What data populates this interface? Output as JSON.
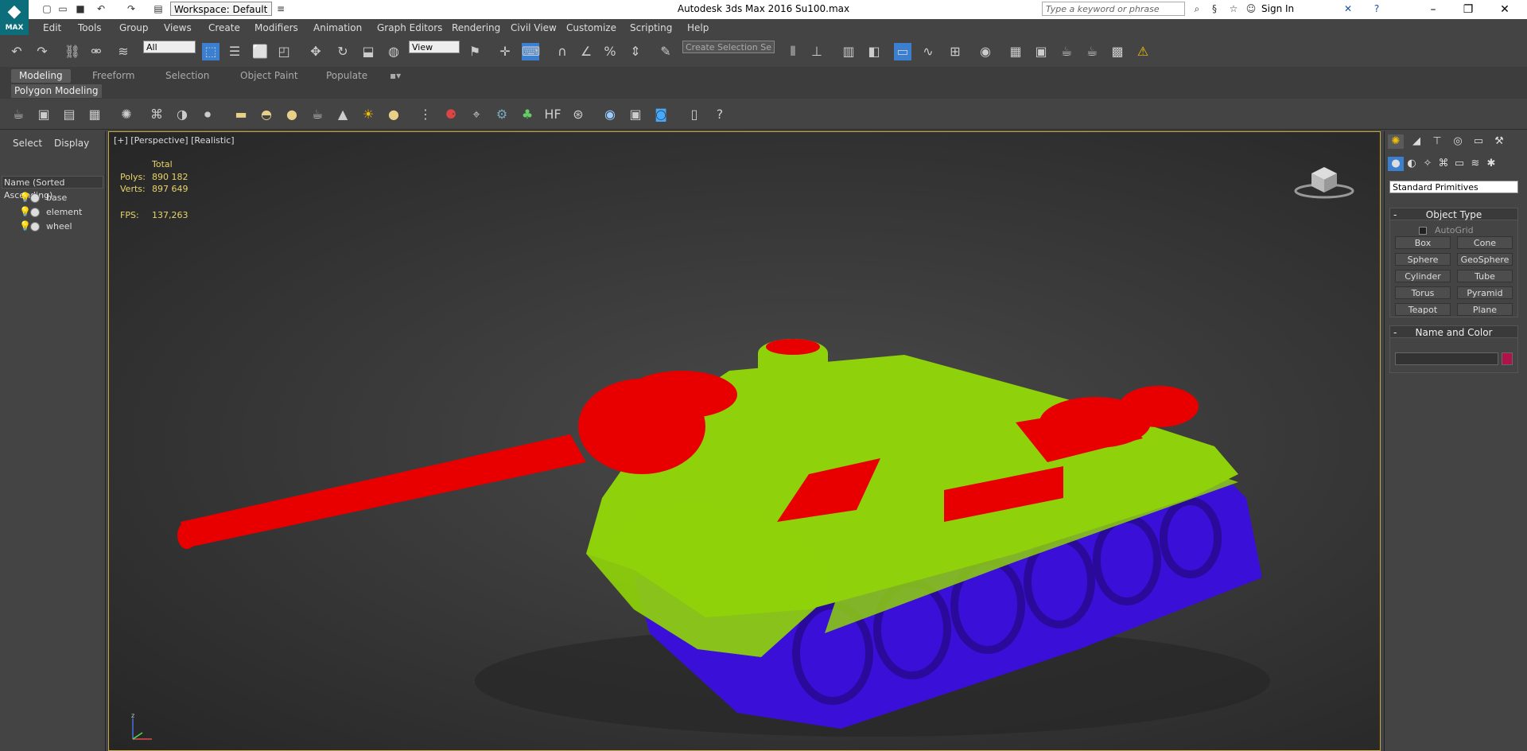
{
  "app": {
    "title": "Autodesk 3ds Max 2016     Su100.max",
    "logo_text": "MAX",
    "workspace": "Workspace: Default",
    "search_placeholder": "Type a keyword or phrase",
    "sign_in": "Sign In"
  },
  "menu": [
    "Edit",
    "Tools",
    "Group",
    "Views",
    "Create",
    "Modifiers",
    "Animation",
    "Graph Editors",
    "Rendering",
    "Civil View",
    "Customize",
    "Scripting",
    "Help"
  ],
  "toolbar": {
    "selection_filter": "All",
    "ref_coord": "View",
    "selection_set_placeholder": "Create Selection Se"
  },
  "ribbon": {
    "tabs": [
      "Modeling",
      "Freeform",
      "Selection",
      "Object Paint",
      "Populate"
    ],
    "active_tab": "Modeling",
    "panel_label": "Polygon Modeling"
  },
  "scene_explorer": {
    "tabs": [
      "Select",
      "Display"
    ],
    "column_header": "Name (Sorted Ascending)",
    "items": [
      "base",
      "element",
      "wheel"
    ]
  },
  "viewport": {
    "label": "[+] [Perspective] [Realistic]",
    "stats": {
      "total_label": "Total",
      "polys_label": "Polys:",
      "polys_value": "890 182",
      "verts_label": "Verts:",
      "verts_value": "897 649",
      "fps_label": "FPS:",
      "fps_value": "137,263"
    },
    "model_colors": {
      "hull": "#8fd10a",
      "gun": "#e80000",
      "wheels": "#3a10d8"
    }
  },
  "command_panel": {
    "dropdown": "Standard Primitives",
    "object_type_title": "Object Type",
    "autogrid": "AutoGrid",
    "buttons": [
      "Box",
      "Cone",
      "Sphere",
      "GeoSphere",
      "Cylinder",
      "Tube",
      "Torus",
      "Pyramid",
      "Teapot",
      "Plane"
    ],
    "name_color_title": "Name and Color",
    "color": "#b0134a"
  }
}
